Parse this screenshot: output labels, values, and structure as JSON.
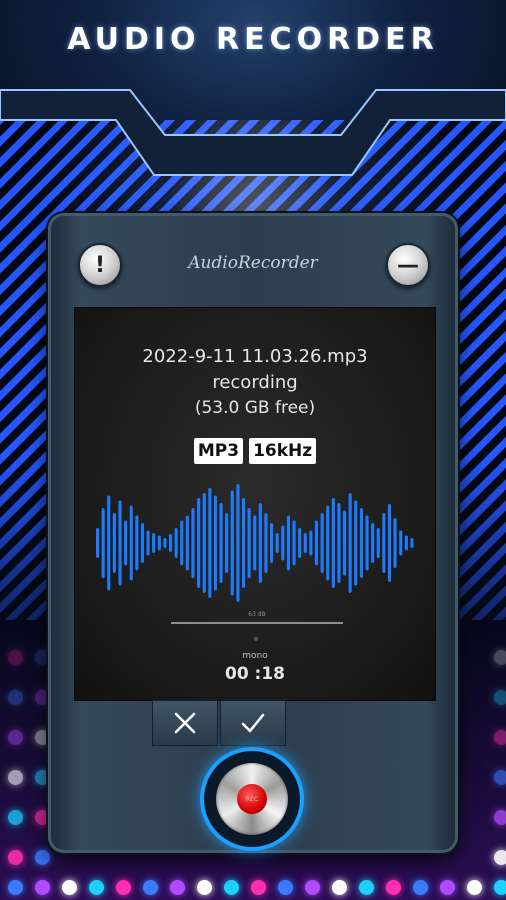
{
  "header": {
    "title": "AUDIO RECORDER"
  },
  "device": {
    "brand_label": "AudioRecorder",
    "info_icon": "exclamation-icon",
    "minus_icon": "minus-icon"
  },
  "screen": {
    "filename": "2022-9-11 11.03.26.mp3",
    "status": "recording",
    "free_space": "(53.0 GB free)",
    "badges": [
      "MP3",
      "16kHz"
    ],
    "db_label": "63 dB",
    "channel": "mono",
    "timer": "00 :18"
  },
  "actions": {
    "cancel_icon": "close-icon",
    "confirm_icon": "checkmark-icon"
  },
  "record": {
    "label": "REC"
  },
  "colors": {
    "waveform": "#1e7bff",
    "stripes": "#2556ff",
    "record_ring": "#1aa0ff",
    "record_dot": "#d40000"
  }
}
